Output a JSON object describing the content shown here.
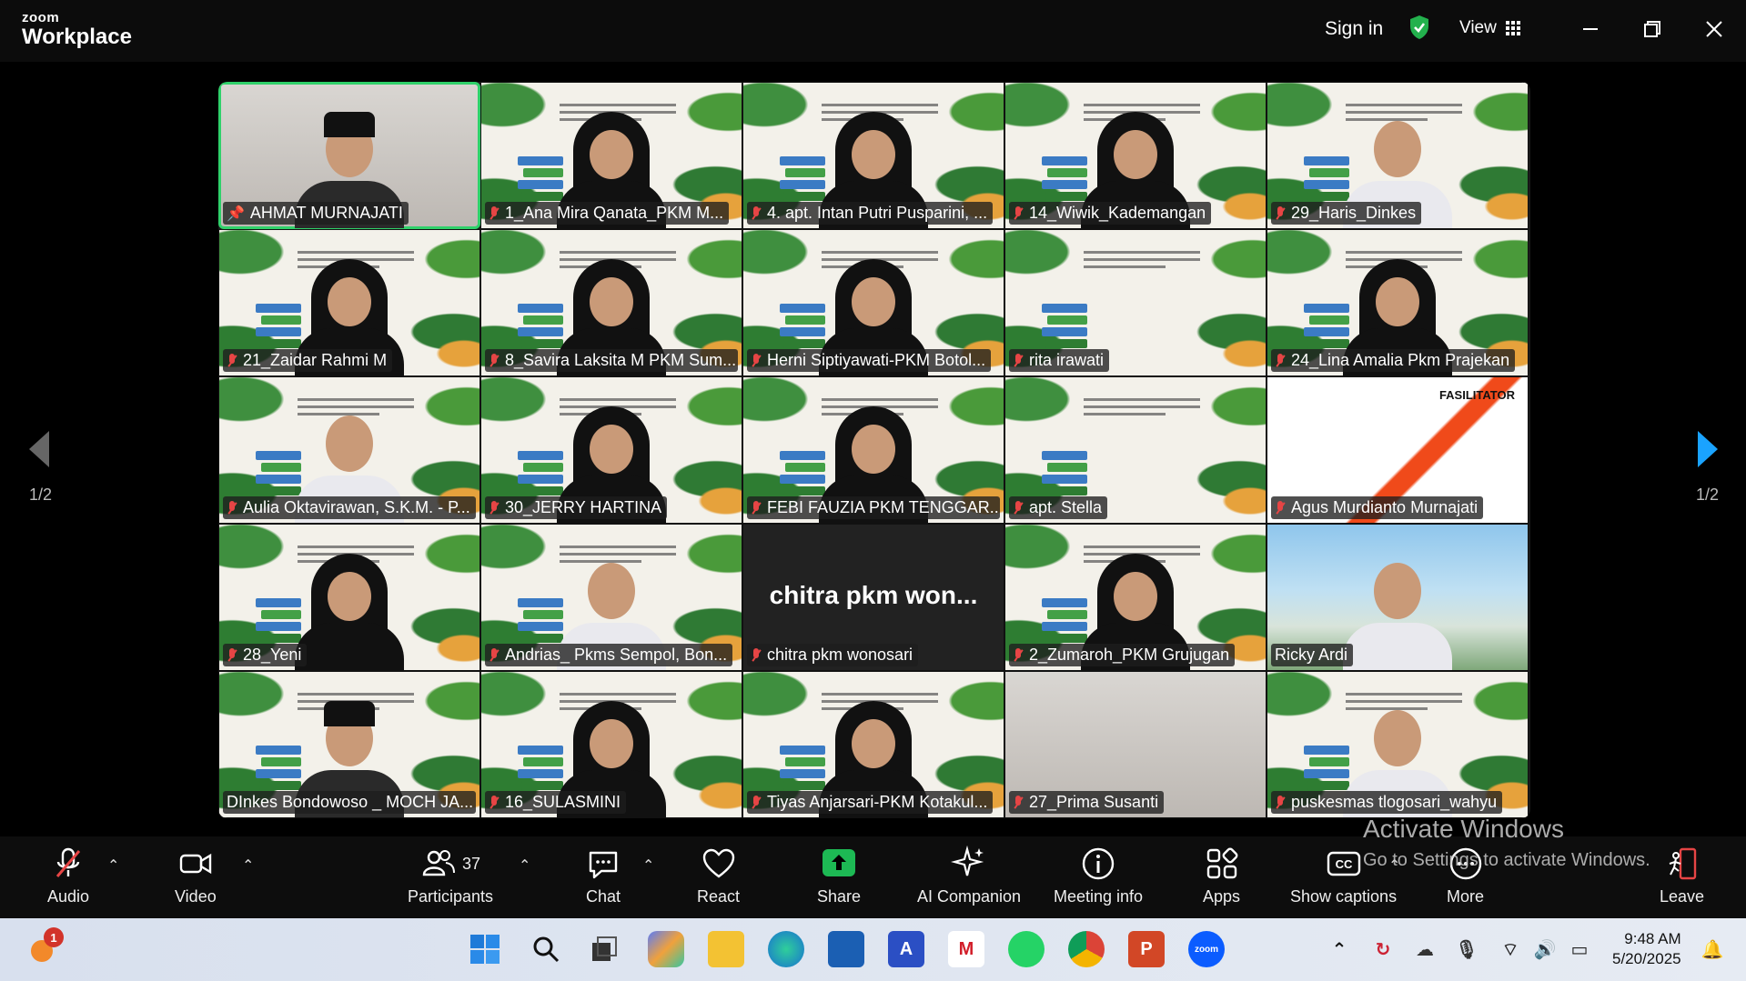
{
  "app": {
    "logo_top": "zoom",
    "logo_bottom": "Workplace"
  },
  "header": {
    "sign_in": "Sign in",
    "view": "View"
  },
  "pagination": {
    "left": "1/2",
    "right": "1/2"
  },
  "tiles": [
    {
      "name": "AHMAT MURNAJATI",
      "muted": false,
      "pinned": true,
      "speaking": true,
      "bg": "room",
      "person": "cap"
    },
    {
      "name": "1_Ana Mira Qanata_PKM M...",
      "muted": true,
      "bg": "banner",
      "person": "hijab"
    },
    {
      "name": "4. apt. Intan Putri Pusparini, ...",
      "muted": true,
      "bg": "banner",
      "person": "hijab"
    },
    {
      "name": "14_Wiwik_Kademangan",
      "muted": true,
      "bg": "banner",
      "person": "hijab"
    },
    {
      "name": "29_Haris_Dinkes",
      "muted": true,
      "bg": "banner",
      "person": "man"
    },
    {
      "name": "21_Zaidar Rahmi M",
      "muted": true,
      "bg": "banner",
      "person": "hijab"
    },
    {
      "name": "8_Savira Laksita M PKM Sum...",
      "muted": true,
      "bg": "banner",
      "person": "hijab"
    },
    {
      "name": "Herni Siptiyawati-PKM Botol...",
      "muted": true,
      "bg": "banner",
      "person": "hijab"
    },
    {
      "name": "rita irawati",
      "muted": true,
      "bg": "banner",
      "person": "none"
    },
    {
      "name": "24_Lina Amalia Pkm Prajekan",
      "muted": true,
      "bg": "banner",
      "person": "hijab"
    },
    {
      "name": "Aulia Oktavirawan, S.K.M. - P...",
      "muted": true,
      "bg": "banner",
      "person": "man"
    },
    {
      "name": "30_JERRY HARTINA",
      "muted": true,
      "bg": "banner",
      "person": "hijab"
    },
    {
      "name": "FEBI FAUZIA PKM TENGGAR...",
      "muted": true,
      "bg": "banner",
      "person": "hijab"
    },
    {
      "name": "apt. Stella",
      "muted": true,
      "bg": "banner",
      "person": "none"
    },
    {
      "name": "Agus Murdianto Murnajati",
      "muted": true,
      "bg": "fasil",
      "person": "none",
      "fasil": "FASILITATOR"
    },
    {
      "name": "28_Yeni",
      "muted": true,
      "bg": "banner",
      "person": "hijab"
    },
    {
      "name": "Andrias_ Pkms Sempol, Bon...",
      "muted": true,
      "bg": "banner",
      "person": "man"
    },
    {
      "name": "chitra pkm wonosari",
      "muted": true,
      "bg": "dark",
      "person": "none",
      "big": "chitra pkm won..."
    },
    {
      "name": "2_Zumaroh_PKM Grujugan",
      "muted": true,
      "bg": "banner",
      "person": "hijab"
    },
    {
      "name": "Ricky Ardi",
      "muted": false,
      "bg": "beach",
      "person": "man"
    },
    {
      "name": "DInkes Bondowoso _ MOCH JA...",
      "muted": false,
      "bg": "banner",
      "person": "cap"
    },
    {
      "name": "16_SULASMINI",
      "muted": true,
      "bg": "banner",
      "person": "hijab"
    },
    {
      "name": "Tiyas Anjarsari-PKM Kotakul...",
      "muted": true,
      "bg": "banner",
      "person": "hijab"
    },
    {
      "name": "27_Prima Susanti",
      "muted": true,
      "bg": "room",
      "person": "none"
    },
    {
      "name": "puskesmas tlogosari_wahyu",
      "muted": true,
      "bg": "banner",
      "person": "man"
    }
  ],
  "toolbar": {
    "audio": "Audio",
    "video": "Video",
    "participants": "Participants",
    "participant_count": "37",
    "chat": "Chat",
    "react": "React",
    "share": "Share",
    "ai_companion": "AI Companion",
    "meeting_info": "Meeting info",
    "apps": "Apps",
    "show_captions": "Show captions",
    "more": "More",
    "leave": "Leave"
  },
  "watermark": {
    "line1": "Activate Windows",
    "line2": "Go to Settings to activate Windows."
  },
  "taskbar": {
    "time": "9:48 AM",
    "date": "5/20/2025",
    "notification_count": "1"
  },
  "colors": {
    "speaking": "#2fd16a",
    "muted": "#e64545",
    "share": "#1db954",
    "accent": "#0b5cff"
  }
}
